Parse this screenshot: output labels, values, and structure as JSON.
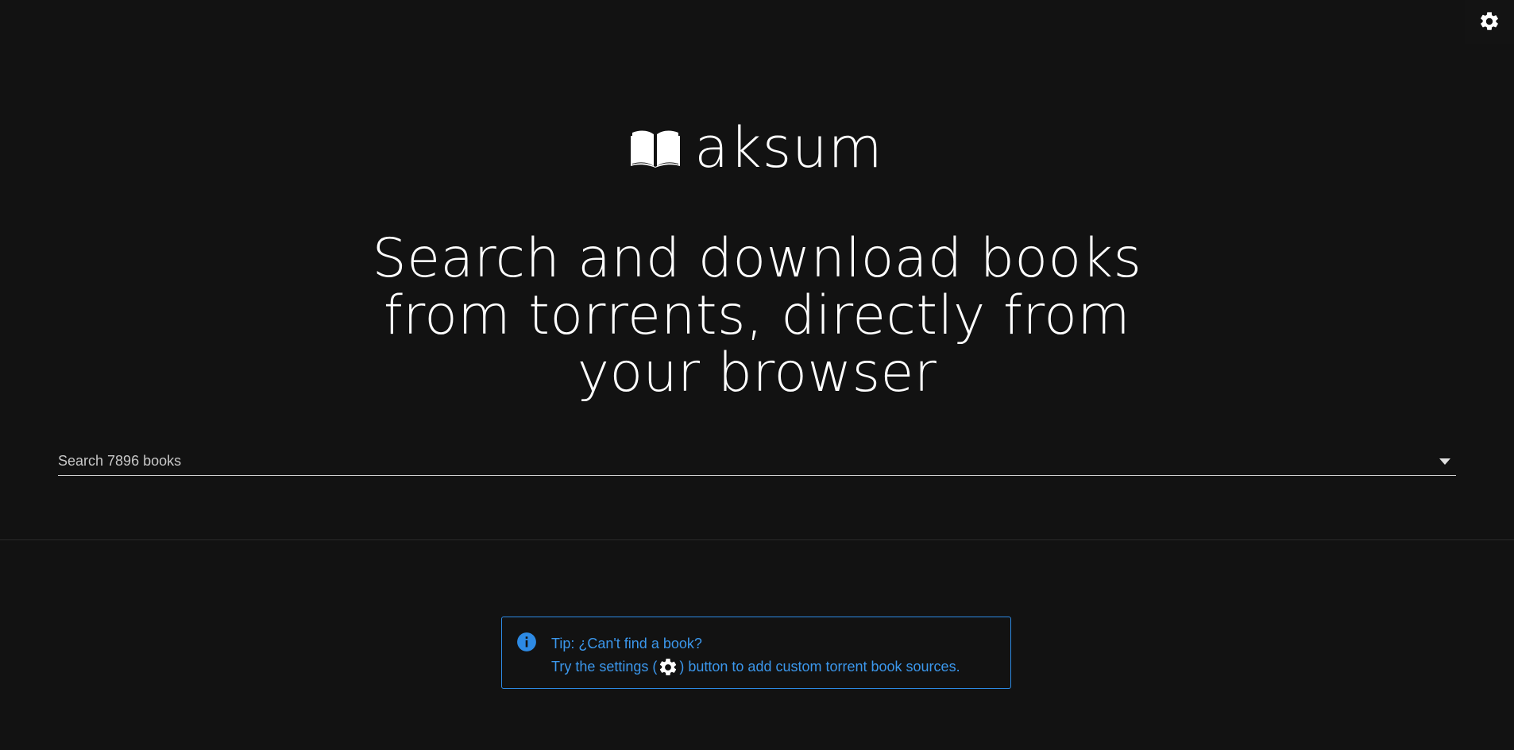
{
  "header": {
    "settings_icon": "gear-icon"
  },
  "brand": {
    "icon": "open-book-icon",
    "name": "aksum"
  },
  "hero": {
    "line1": "Search and download books",
    "line2": "from torrents, directly from",
    "line3": "your browser"
  },
  "search": {
    "placeholder": "Search 7896 books",
    "value": "",
    "dropdown_icon": "caret-down-icon"
  },
  "tip": {
    "icon": "info-icon",
    "title": "Tip: ¿Can't find a book?",
    "body_before": "Try the settings (",
    "body_after": ") button to add custom torrent book sources.",
    "accent_color": "#2d8ae4"
  }
}
